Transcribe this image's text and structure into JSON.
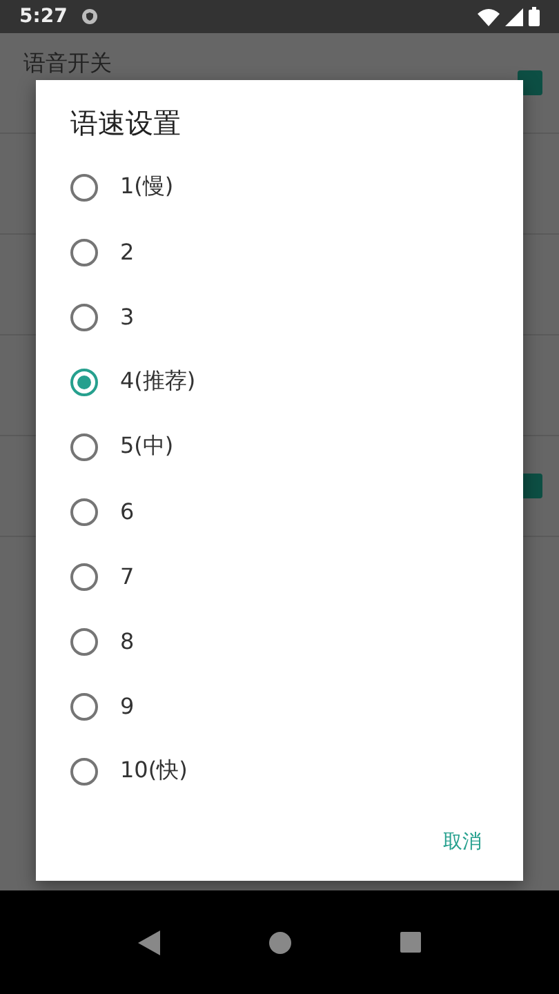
{
  "status_bar": {
    "time": "5:27"
  },
  "settings": [
    {
      "title": "语音开关",
      "kind": "checkbox",
      "checked": true
    },
    {
      "kind": "plain"
    },
    {
      "kind": "plain"
    },
    {
      "kind": "plain"
    },
    {
      "kind": "checkbox",
      "checked": true
    }
  ],
  "dialog": {
    "title": "语速设置",
    "options": [
      {
        "label": "1(慢)",
        "selected": false
      },
      {
        "label": "2",
        "selected": false
      },
      {
        "label": "3",
        "selected": false
      },
      {
        "label": "4(推荐)",
        "selected": true
      },
      {
        "label": "5(中)",
        "selected": false
      },
      {
        "label": "6",
        "selected": false
      },
      {
        "label": "7",
        "selected": false
      },
      {
        "label": "8",
        "selected": false
      },
      {
        "label": "9",
        "selected": false
      },
      {
        "label": "10(快)",
        "selected": false
      }
    ],
    "cancel": "取消"
  }
}
